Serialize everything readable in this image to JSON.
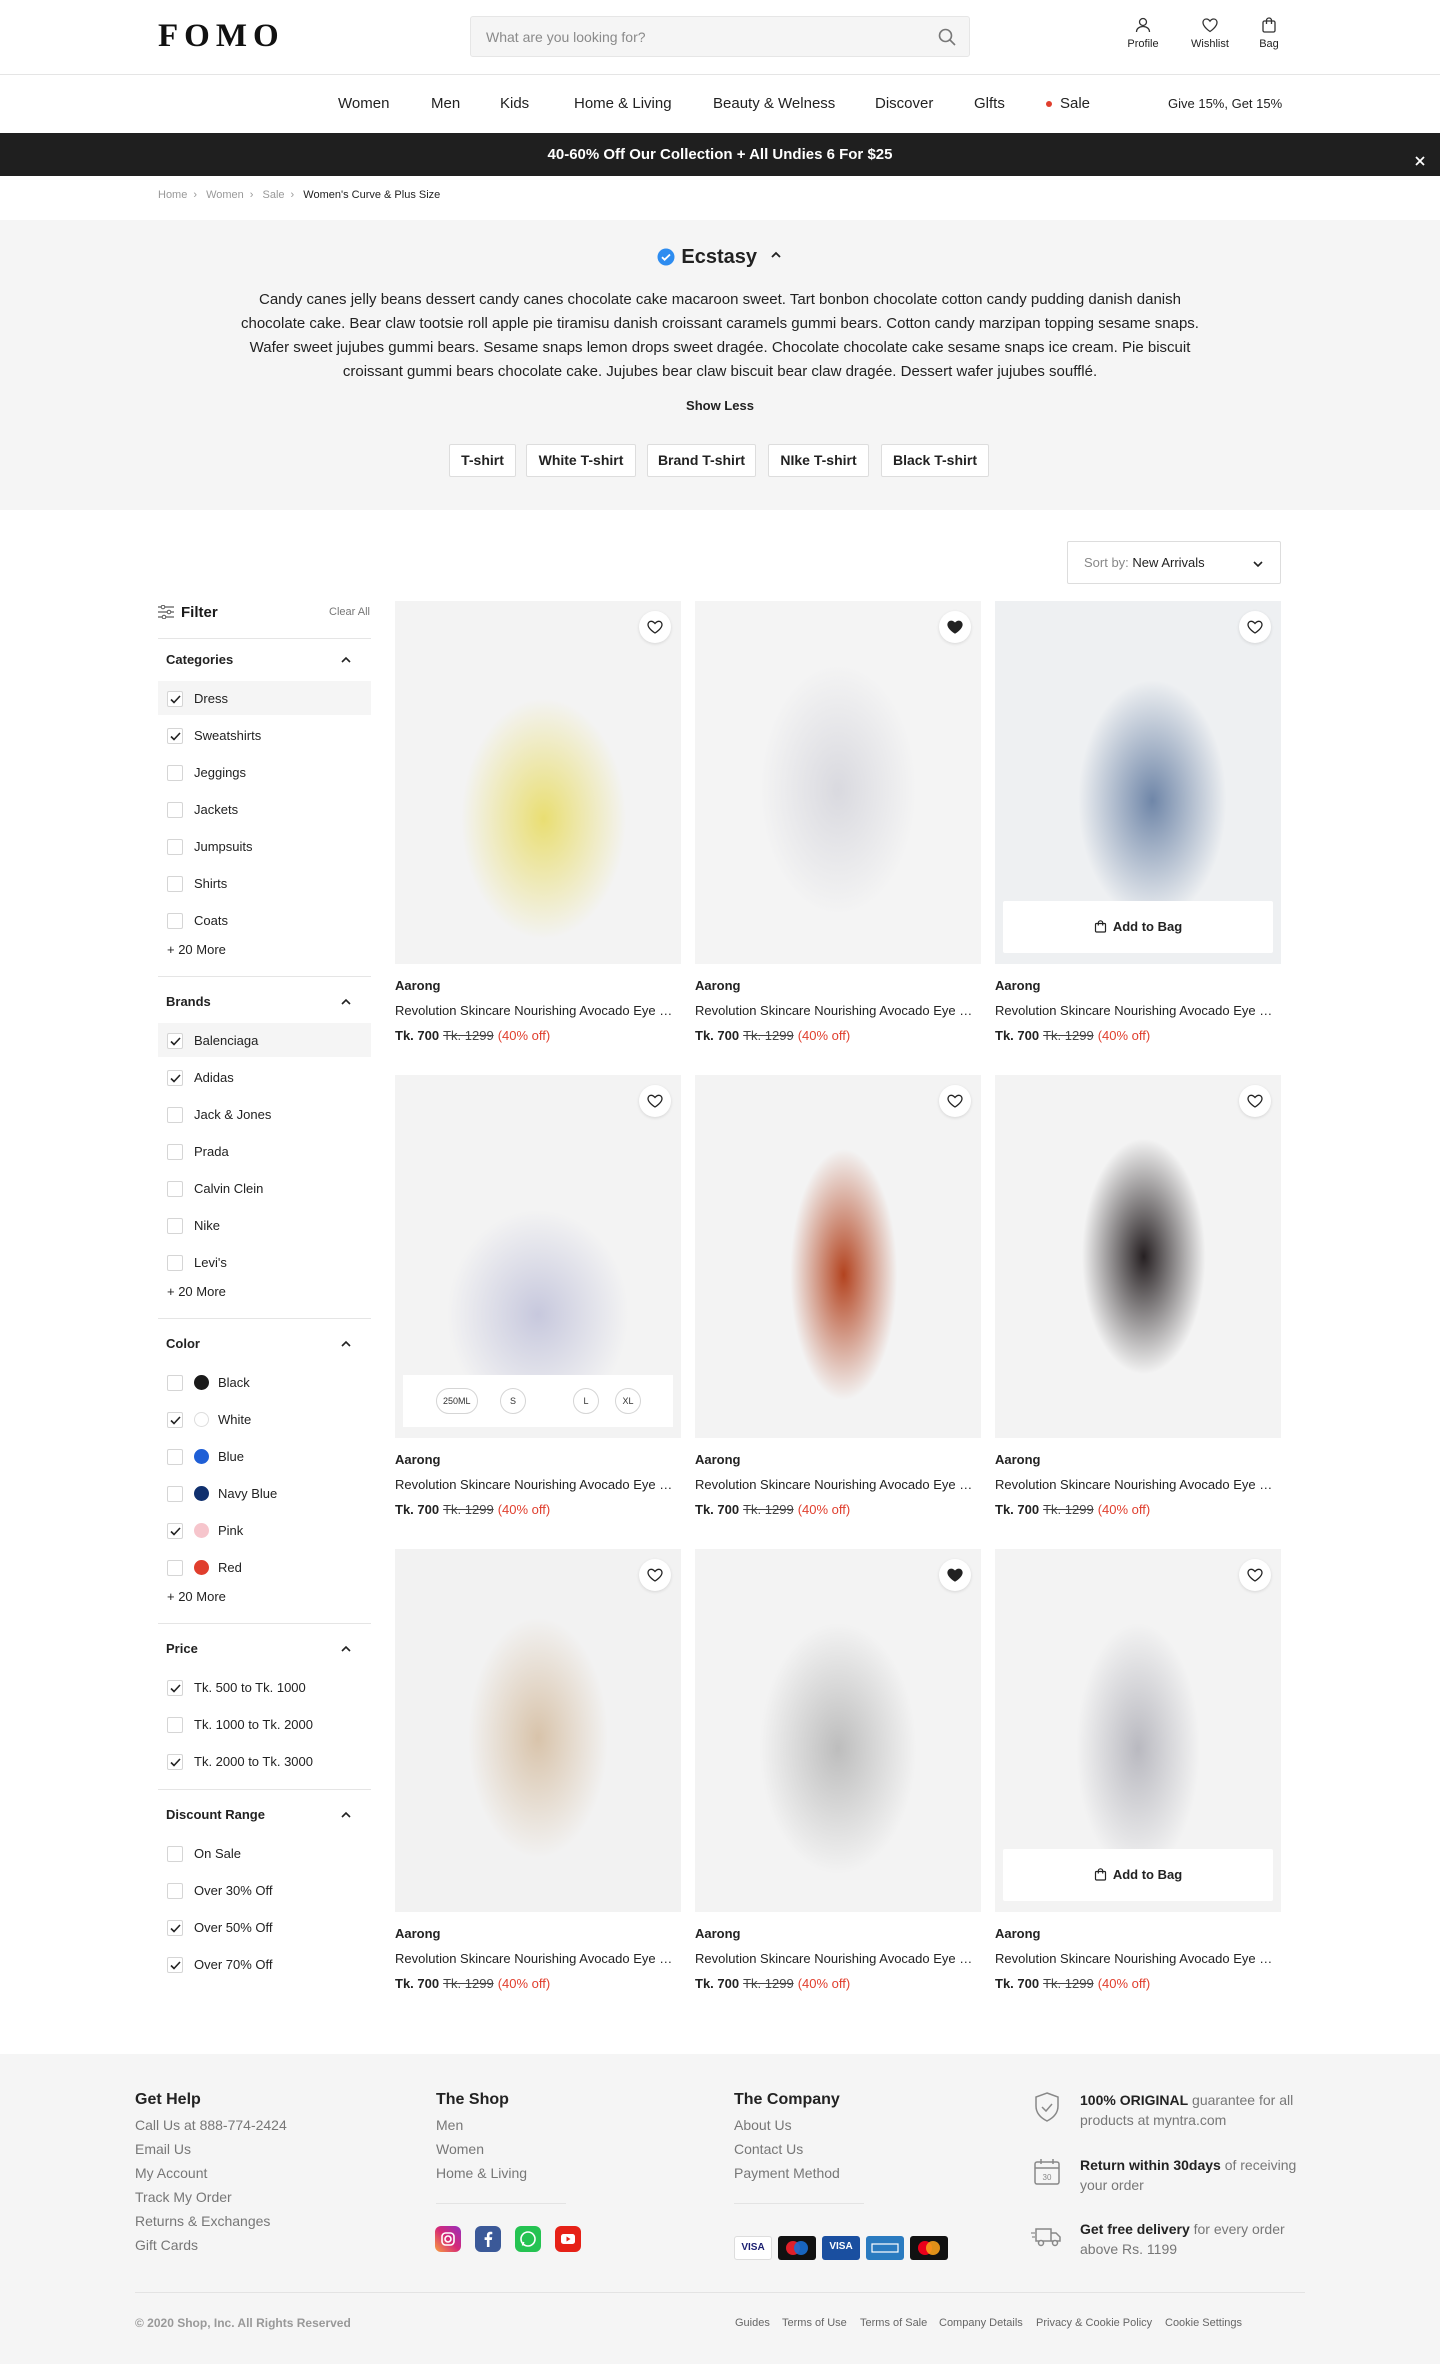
{
  "header": {
    "logo": "FOMO",
    "search_placeholder": "What are you looking for?",
    "actions": [
      "Profile",
      "Wishlist",
      "Bag"
    ]
  },
  "nav": {
    "items": [
      "Women",
      "Men",
      "Kids",
      "Home & Living",
      "Beauty & Welness",
      "Discover",
      "Glfts",
      "Sale"
    ],
    "promo_right": "Give 15%, Get 15%"
  },
  "promo_banner": "40-60% Off Our Collection + All Undies 6 For $25",
  "breadcrumb": [
    "Home",
    "Women",
    "Sale",
    "Women's Curve & Plus Size"
  ],
  "hero": {
    "title": "Ecstasy",
    "description": "Candy canes jelly beans dessert candy canes chocolate cake macaroon sweet. Tart bonbon chocolate cotton candy pudding danish danish chocolate cake. Bear claw tootsie roll apple pie tiramisu danish croissant caramels gummi bears. Cotton candy marzipan topping sesame snaps. Wafer sweet jujubes gummi bears. Sesame snaps lemon drops sweet dragée. Chocolate chocolate cake sesame snaps ice cream. Pie biscuit croissant gummi bears chocolate cake. Jujubes bear claw biscuit bear claw dragée. Dessert wafer jujubes soufflé.",
    "show_less": "Show Less",
    "tags": [
      "T-shirt",
      "White T-shirt",
      "Brand T-shirt",
      "NIke T-shirt",
      "Black T-shirt"
    ]
  },
  "sort": {
    "label": "Sort by:",
    "value": "New Arrivals"
  },
  "filter": {
    "title": "Filter",
    "clear": "Clear All",
    "sections": [
      {
        "title": "Categories",
        "more": "+ 20 More",
        "options": [
          {
            "label": "Dress",
            "checked": true
          },
          {
            "label": "Sweatshirts",
            "checked": true
          },
          {
            "label": "Jeggings",
            "checked": false
          },
          {
            "label": "Jackets",
            "checked": false
          },
          {
            "label": "Jumpsuits",
            "checked": false
          },
          {
            "label": "Shirts",
            "checked": false
          },
          {
            "label": "Coats",
            "checked": false
          }
        ]
      },
      {
        "title": "Brands",
        "more": "+ 20 More",
        "options": [
          {
            "label": "Balenciaga",
            "checked": true
          },
          {
            "label": "Adidas",
            "checked": true
          },
          {
            "label": "Jack & Jones",
            "checked": false
          },
          {
            "label": "Prada",
            "checked": false
          },
          {
            "label": "Calvin Clein",
            "checked": false
          },
          {
            "label": "Nike",
            "checked": false
          },
          {
            "label": "Levi's",
            "checked": false
          }
        ]
      },
      {
        "title": "Color",
        "more": "+ 20 More",
        "options": [
          {
            "label": "Black",
            "checked": false,
            "color": "#1a1a1a"
          },
          {
            "label": "White",
            "checked": true,
            "color": "#ffffff"
          },
          {
            "label": "Blue",
            "checked": false,
            "color": "#1f5fd6"
          },
          {
            "label": "Navy Blue",
            "checked": false,
            "color": "#10306e"
          },
          {
            "label": "Pink",
            "checked": true,
            "color": "#f6c5cc"
          },
          {
            "label": "Red",
            "checked": false,
            "color": "#e03e2d"
          }
        ]
      },
      {
        "title": "Price",
        "options": [
          {
            "label": "Tk. 500 to Tk. 1000",
            "checked": true
          },
          {
            "label": "Tk. 1000 to Tk. 2000",
            "checked": false
          },
          {
            "label": "Tk. 2000 to Tk. 3000",
            "checked": true
          }
        ]
      },
      {
        "title": "Discount Range",
        "options": [
          {
            "label": "On Sale",
            "checked": false
          },
          {
            "label": "Over 30% Off",
            "checked": false
          },
          {
            "label": "Over 50% Off",
            "checked": true
          },
          {
            "label": "Over 70% Off",
            "checked": true
          }
        ]
      }
    ]
  },
  "products": [
    {
      "brand": "Aarong",
      "name": "Revolution Skincare Nourishing Avocado Eye Cream",
      "price": "Tk. 700",
      "old_price": "Tk. 1299",
      "discount": "(40% off)",
      "wishlisted": false,
      "overlay": "none"
    },
    {
      "brand": "Aarong",
      "name": "Revolution Skincare Nourishing Avocado Eye Cream",
      "price": "Tk. 700",
      "old_price": "Tk. 1299",
      "discount": "(40% off)",
      "wishlisted": true,
      "overlay": "none"
    },
    {
      "brand": "Aarong",
      "name": "Revolution Skincare Nourishing Avocado Eye Cream",
      "price": "Tk. 700",
      "old_price": "Tk. 1299",
      "discount": "(40% off)",
      "wishlisted": false,
      "overlay": "bag"
    },
    {
      "brand": "Aarong",
      "name": "Revolution Skincare Nourishing Avocado Eye Cream",
      "price": "Tk. 700",
      "old_price": "Tk. 1299",
      "discount": "(40% off)",
      "wishlisted": false,
      "overlay": "sizes"
    },
    {
      "brand": "Aarong",
      "name": "Revolution Skincare Nourishing Avocado Eye Cream",
      "price": "Tk. 700",
      "old_price": "Tk. 1299",
      "discount": "(40% off)",
      "wishlisted": false,
      "overlay": "none"
    },
    {
      "brand": "Aarong",
      "name": "Revolution Skincare Nourishing Avocado Eye Cream",
      "price": "Tk. 700",
      "old_price": "Tk. 1299",
      "discount": "(40% off)",
      "wishlisted": false,
      "overlay": "none"
    },
    {
      "brand": "Aarong",
      "name": "Revolution Skincare Nourishing Avocado Eye Cream",
      "price": "Tk. 700",
      "old_price": "Tk. 1299",
      "discount": "(40% off)",
      "wishlisted": false,
      "overlay": "none"
    },
    {
      "brand": "Aarong",
      "name": "Revolution Skincare Nourishing Avocado Eye Cream",
      "price": "Tk. 700",
      "old_price": "Tk. 1299",
      "discount": "(40% off)",
      "wishlisted": true,
      "overlay": "none"
    },
    {
      "brand": "Aarong",
      "name": "Revolution Skincare Nourishing Avocado Eye Cream",
      "price": "Tk. 700",
      "old_price": "Tk. 1299",
      "discount": "(40% off)",
      "wishlisted": false,
      "overlay": "bag"
    }
  ],
  "add_to_bag": "Add to Bag",
  "sizes": [
    "250ML",
    "S",
    "L",
    "XL"
  ],
  "footer": {
    "get_help": {
      "title": "Get Help",
      "links": [
        "Call Us at 888-774-2424",
        "Email Us",
        "My Account",
        "Track My Order",
        "Returns & Exchanges",
        "Gift Cards"
      ]
    },
    "the_shop": {
      "title": "The Shop",
      "links": [
        "Men",
        "Women",
        "Home & Living"
      ]
    },
    "the_company": {
      "title": "The Company",
      "links": [
        "About Us",
        "Contact Us",
        "Payment Method"
      ]
    },
    "badges": [
      {
        "bold": "100% ORIGINAL",
        "rest": " guarantee for all products at myntra.com"
      },
      {
        "bold": "Return within 30days",
        "rest": " of receiving your order"
      },
      {
        "bold": "Get free delivery",
        "rest": " for every order above Rs. 1199"
      }
    ],
    "calendar_day": "30",
    "payment_cards": [
      "VISA",
      "",
      "VISA",
      "",
      ""
    ],
    "copyright": "© 2020 Shop, Inc. All Rights Reserved",
    "bottom_links": [
      "Guides",
      "Terms of Use",
      "Terms of Sale",
      "Company Details",
      "Privacy & Cookie Policy",
      "Cookie Settings"
    ]
  }
}
